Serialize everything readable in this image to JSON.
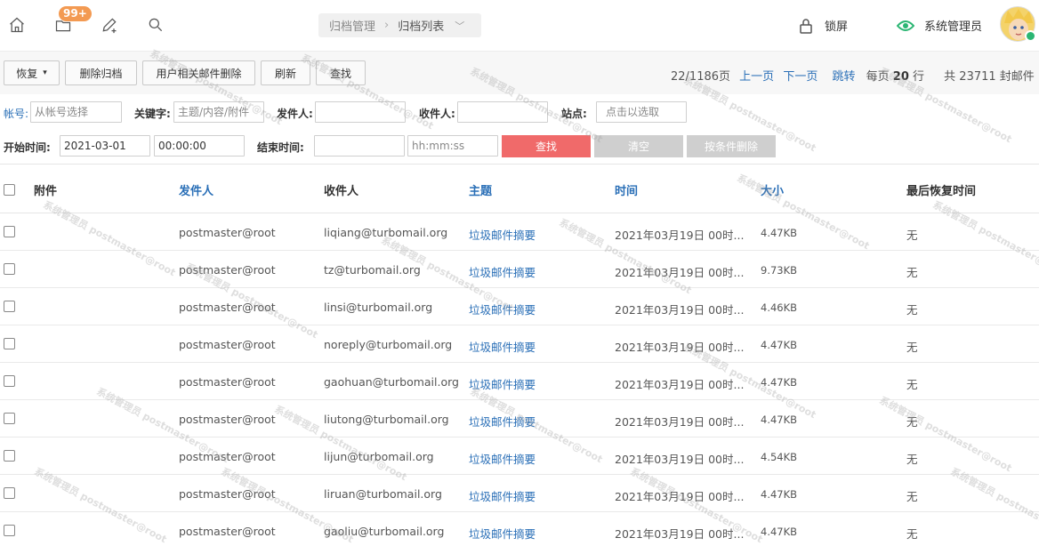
{
  "topbar": {
    "badge": "99+",
    "breadcrumb": {
      "parent": "归档管理",
      "current": "归档列表"
    },
    "lock_label": "锁屏",
    "admin_label": "系统管理员"
  },
  "toolbar": {
    "restore_label": "恢复",
    "delete_archive_label": "删除归档",
    "delete_user_mail_label": "用户相关邮件删除",
    "refresh_label": "刷新",
    "search_label": "查找",
    "pager": {
      "page_info": "22/1186页",
      "prev": "上一页",
      "next": "下一页",
      "jump": "跳转",
      "per_page_prefix": "每页",
      "per_page_value": "20",
      "per_page_suffix": "行",
      "total": "共 23711 封邮件"
    }
  },
  "filter": {
    "account_label": "帐号:",
    "account_placeholder": "从帐号选择",
    "keyword_label": "关键字:",
    "keyword_placeholder": "主题/内容/附件",
    "sender_label": "发件人:",
    "recipient_label": "收件人:",
    "site_label": "站点:",
    "site_placeholder": "点击以选取",
    "start_label": "开始时间:",
    "start_date": "2021-03-01",
    "start_time": "00:00:00",
    "end_label": "结束时间:",
    "end_time_placeholder": "hh:mm:ss",
    "search_button": "查找",
    "clear_button": "清空",
    "delete_by_cond_button": "按条件删除"
  },
  "table": {
    "headers": [
      "附件",
      "发件人",
      "收件人",
      "主题",
      "时间",
      "大小",
      "最后恢复时间"
    ],
    "rows": [
      {
        "sender": "postmaster@root",
        "recipient": "liqiang@turbomail.org",
        "subject": "垃圾邮件摘要",
        "time": "2021年03月19日 00时...",
        "size": "4.47KB",
        "last_restore": "无"
      },
      {
        "sender": "postmaster@root",
        "recipient": "tz@turbomail.org",
        "subject": "垃圾邮件摘要",
        "time": "2021年03月19日 00时...",
        "size": "9.73KB",
        "last_restore": "无"
      },
      {
        "sender": "postmaster@root",
        "recipient": "linsi@turbomail.org",
        "subject": "垃圾邮件摘要",
        "time": "2021年03月19日 00时...",
        "size": "4.46KB",
        "last_restore": "无"
      },
      {
        "sender": "postmaster@root",
        "recipient": "noreply@turbomail.org",
        "subject": "垃圾邮件摘要",
        "time": "2021年03月19日 00时...",
        "size": "4.47KB",
        "last_restore": "无"
      },
      {
        "sender": "postmaster@root",
        "recipient": "gaohuan@turbomail.org",
        "subject": "垃圾邮件摘要",
        "time": "2021年03月19日 00时...",
        "size": "4.47KB",
        "last_restore": "无"
      },
      {
        "sender": "postmaster@root",
        "recipient": "liutong@turbomail.org",
        "subject": "垃圾邮件摘要",
        "time": "2021年03月19日 00时...",
        "size": "4.47KB",
        "last_restore": "无"
      },
      {
        "sender": "postmaster@root",
        "recipient": "lijun@turbomail.org",
        "subject": "垃圾邮件摘要",
        "time": "2021年03月19日 00时...",
        "size": "4.54KB",
        "last_restore": "无"
      },
      {
        "sender": "postmaster@root",
        "recipient": "liruan@turbomail.org",
        "subject": "垃圾邮件摘要",
        "time": "2021年03月19日 00时...",
        "size": "4.47KB",
        "last_restore": "无"
      },
      {
        "sender": "postmaster@root",
        "recipient": "gaoliu@turbomail.org",
        "subject": "垃圾邮件摘要",
        "time": "2021年03月19日 00时...",
        "size": "4.47KB",
        "last_restore": "无"
      }
    ]
  },
  "watermark": "系统管理员 postmaster@root",
  "colors": {
    "link": "#2a6fb7",
    "badge": "#f39a52",
    "search_button": "#f06a6a",
    "disabled_button": "#cfcfcf",
    "admin_icon": "#2bb673"
  },
  "icons": [
    "home-icon",
    "folder-icon",
    "compose-icon",
    "search-icon",
    "lock-icon",
    "eye-icon",
    "chevron-down-icon"
  ]
}
